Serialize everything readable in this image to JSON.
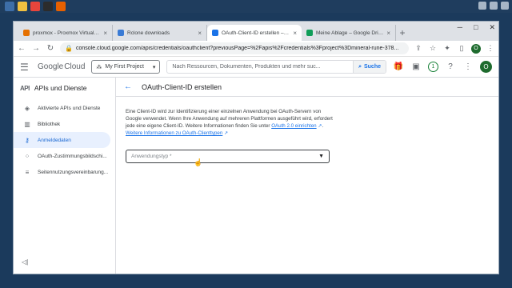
{
  "browser": {
    "tabs": [
      {
        "title": "proxmox - Proxmox Virtual Enviro",
        "fav_color": "#e57000"
      },
      {
        "title": "Rclone downloads",
        "fav_color": "#3a7bd5"
      },
      {
        "title": "OAuth-Client-ID erstellen – APIs",
        "fav_color": "#1a73e8"
      },
      {
        "title": "Meine Ablage – Google Drive",
        "fav_color": "#0f9d58"
      }
    ],
    "url": "console.cloud.google.com/apis/credentials/oauthclient?previousPage=%2Fapis%2Fcredentials%3Fproject%3Dmineral-rune-378...",
    "profile_letter": "O"
  },
  "header": {
    "logo_google": "Google",
    "logo_cloud": "Cloud",
    "project": "My First Project",
    "search_placeholder": "Nach Ressourcen, Dokumenten, Produkten und mehr suc...",
    "search_button": "Suche",
    "notification_count": "1",
    "avatar_letter": "O"
  },
  "sidebar": {
    "title": "APIs und Dienste",
    "api_logo": "API",
    "items": [
      {
        "label": "Aktivierte APIs und Dienste",
        "icon": "diamond-icon"
      },
      {
        "label": "Bibliothek",
        "icon": "library-icon"
      },
      {
        "label": "Anmeldedaten",
        "icon": "key-icon"
      },
      {
        "label": "OAuth-Zustimmungsbildschi...",
        "icon": "consent-icon"
      },
      {
        "label": "Seitennutzungsvereinbarung...",
        "icon": "settings-list-icon"
      }
    ]
  },
  "page": {
    "title": "OAuth-Client-ID erstellen",
    "desc_1": "Eine Client-ID wird zur Identifizierung einer einzelnen Anwendung bei OAuth-Servern von Google verwendet. Wenn Ihre Anwendung auf mehreren Plattformen ausgeführt wird, erfordert jede eine eigene Client-ID. Weitere Informationen finden Sie unter ",
    "link_1": "OAuth 2.0 einrichten",
    "link_2": "Weitere Informationen zu OAuth-Clienttypen",
    "select_placeholder": "Anwendungstyp *"
  }
}
